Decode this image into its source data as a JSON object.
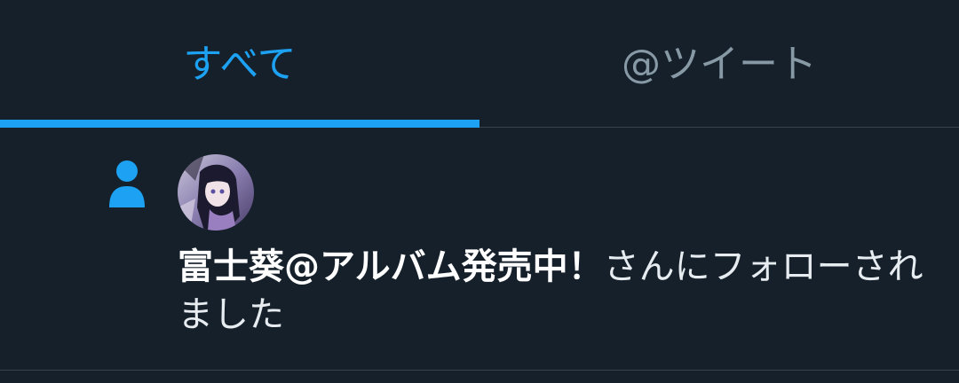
{
  "tabs": [
    {
      "label": "すべて",
      "active": true
    },
    {
      "label": "@ツイート",
      "active": false
    }
  ],
  "notification": {
    "type_icon": "person-icon",
    "avatar_icon": "user-avatar",
    "user_name": "富士葵@アルバム発売中！",
    "followed_text": "さんにフォローされました"
  },
  "colors": {
    "background": "#15202b",
    "accent": "#1da1f2",
    "inactive_tab": "#8899a6",
    "divider": "#38444d",
    "text": "#ffffff"
  }
}
